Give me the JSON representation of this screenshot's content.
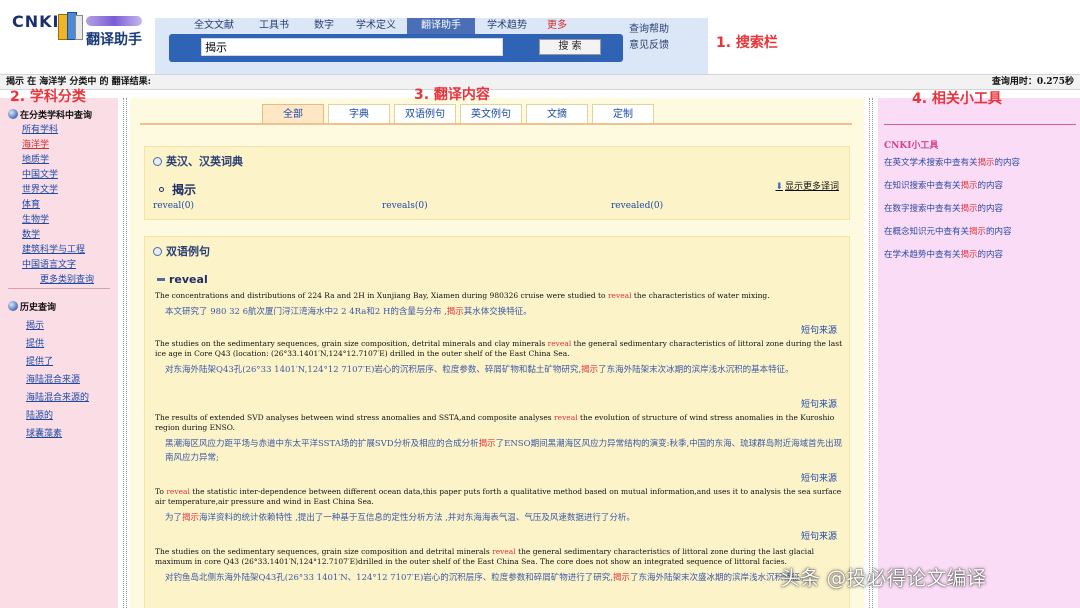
{
  "logo": {
    "brand": "CNKI",
    "subtitle": "翻译助手"
  },
  "nav_tabs": [
    {
      "label": "全文文献",
      "width": 62
    },
    {
      "label": "工具书",
      "width": 58
    },
    {
      "label": "数字",
      "width": 42
    },
    {
      "label": "学术定义",
      "width": 62
    },
    {
      "label": "翻译助手",
      "width": 68,
      "active": true
    },
    {
      "label": "学术趋势",
      "width": 64
    },
    {
      "label": "更多",
      "width": 36,
      "more": true
    }
  ],
  "search": {
    "query": "揭示",
    "button_label": "搜 索"
  },
  "help_links": {
    "help": "查询帮助",
    "feedback": "意见反馈"
  },
  "annotations": {
    "search_bar": "1. 搜索栏",
    "categories": "2. 学科分类",
    "translation_content": "3. 翻译内容",
    "related_tools": "4. 相关小工具"
  },
  "result_bar": {
    "left": "揭示 在 海洋学 分类中 的 翻译结果:",
    "right": "查询用时：0.275秒"
  },
  "left_sidebar": {
    "category_heading": "在分类学科中查询",
    "categories": [
      "所有学科",
      "海洋学",
      "地质学",
      "中国文学",
      "世界文学",
      "体育",
      "生物学",
      "数学",
      "建筑科学与工程",
      "中国语言文字"
    ],
    "active_category": "海洋学",
    "more_link": "更多类别查询",
    "history_heading": "历史查询",
    "history": [
      "揭示",
      "提供",
      "提供了",
      "海陆混合来源",
      "海陆混合来源的",
      "陆源的",
      "球囊藻素"
    ]
  },
  "content_tabs": [
    "全部",
    "字典",
    "双语例句",
    "英文例句",
    "文摘",
    "定制"
  ],
  "dictionary": {
    "heading": "英汉、汉英词典",
    "word": "揭示",
    "more_link": "显示更多译词",
    "terms": [
      "reveal(0)",
      "reveals(0)",
      "revealed(0)"
    ]
  },
  "examples": {
    "heading": "双语例句",
    "keyword": "reveal",
    "source_label": "短句来源",
    "items": [
      {
        "en_pre": "The concentrations and distributions of 224 Ra and 2H in Xunjiang Bay, Xiamen during 980326 cruise were studied to ",
        "en_kw": "reveal",
        "en_post": " the characteristics of water mixing.",
        "zh_pre": "本文研究了 980 32 6航次厦门浔江湾海水中2 2 4Ra和2 H的含量与分布 ,",
        "zh_kw": "揭示",
        "zh_post": "其水体交换特征。"
      },
      {
        "en_pre": "The studies on the sedimentary sequences, grain size composition, detrital minerals and clay minerals ",
        "en_kw": "reveal",
        "en_post": " the general sedimentary characteristics of littoral zone during the last ice age in Core Q43 (location: (26°33.1401′N,124°12.7107′E) drilled in the outer shelf of the East China Sea.",
        "zh_pre": "对东海外陆架Q43孔(26°33 1401′N,124°12 7107′E)岩心的沉积层序、粒度参数、碎屑矿物和黏土矿物研究,",
        "zh_kw": "揭示",
        "zh_post": "了东海外陆架末次冰期的滨岸浅水沉积的基本特征。"
      },
      {
        "en_pre": "The results of extended SVD analyses between wind stress anomalies and SSTA,and composite analyses ",
        "en_kw": "reveal",
        "en_post": " the evolution of structure of wind stress anomalies in the Kuroshio region during ENSO.",
        "zh_pre": "黑潮海区风应力距平场与赤道中东太平洋SSTA场的扩展SVD分析及相应的合成分析",
        "zh_kw": "揭示",
        "zh_post": "了ENSO期间黑潮海区风应力异常结构的演变:秋季,中国的东海、琉球群岛附近海域首先出现南风应力异常;"
      },
      {
        "en_pre": "To ",
        "en_kw": "reveal",
        "en_post": " the statistic inter-dependence between different ocean data,this paper puts forth a qualitative method based on mutual information,and uses it to analysis the sea surface air temperature,air pressure and wind in East China Sea.",
        "zh_pre": "为了",
        "zh_kw": "揭示",
        "zh_post": "海洋资料的统计依赖特性 ,提出了一种基于互信息的定性分析方法 ,并对东海海表气温、气压及风速数据进行了分析。"
      },
      {
        "en_pre": "The studies on the sedimentary sequences, grain size composition and detrital minerals ",
        "en_kw": "reveal",
        "en_post": " the general sedimentary characteristics of littoral zone during the last glacial maximum in core Q43 (26°33.1401′N,124°12.7107′E)drilled in the outer shelf of the East China Sea. The core does not show an integrated sequence of littoral facies.",
        "zh_pre": "对钓鱼岛北侧东海外陆架Q43孔(26°33 1401′N、124°12 7107′E)岩心的沉积层序、粒度参数和碎屑矿物进行了研究,",
        "zh_kw": "揭示",
        "zh_post": "了东海外陆架末次盛冰期的滨岸浅水沉积特征。"
      }
    ]
  },
  "right_sidebar": {
    "title": "CNKI小工具",
    "tools": [
      {
        "pre": "在英文学术搜索中查有关",
        "kw": "揭示",
        "post": "的内容"
      },
      {
        "pre": "在知识搜索中查有关",
        "kw": "揭示",
        "post": "的内容"
      },
      {
        "pre": "在数字搜索中查有关",
        "kw": "揭示",
        "post": "的内容"
      },
      {
        "pre": "在概念知识元中查有关",
        "kw": "揭示",
        "post": "的内容"
      },
      {
        "pre": "在学术趋势中查有关",
        "kw": "揭示",
        "post": "的内容"
      }
    ]
  },
  "watermark": "头条 @投必得论文编译",
  "colors": {
    "annotation_red": "#e8343a",
    "link_blue": "#1b4aa8",
    "highlight_red": "#e2343a"
  }
}
